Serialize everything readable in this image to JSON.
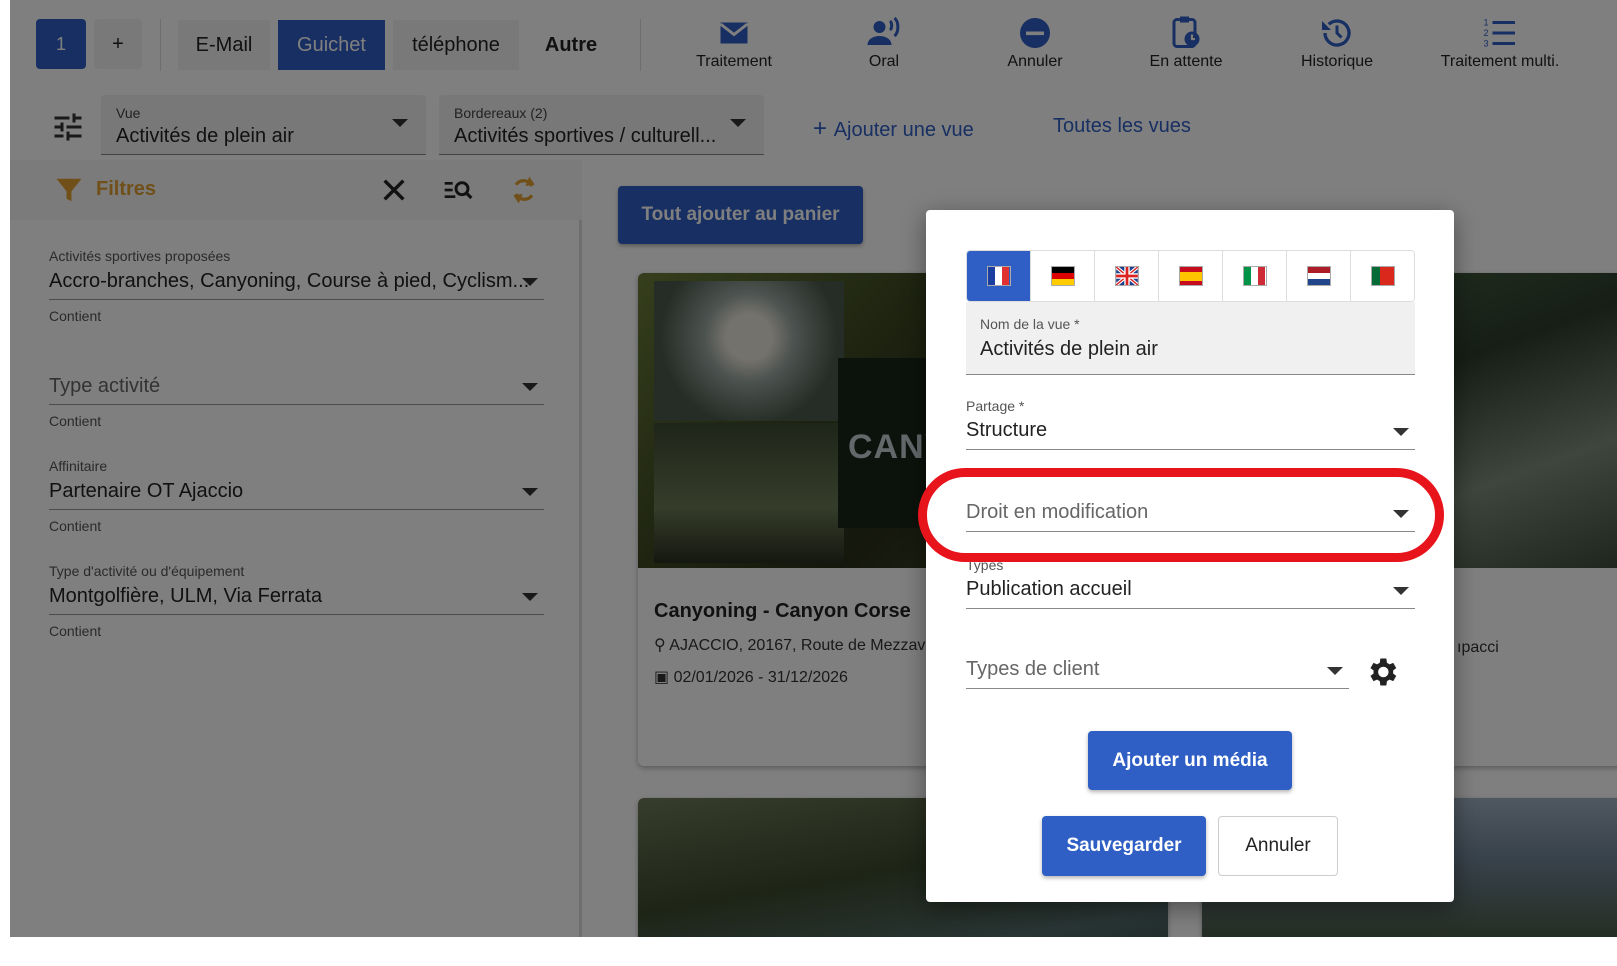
{
  "topbar": {
    "counter": "1",
    "add": "+",
    "channels": {
      "email": "E-Mail",
      "guichet": "Guichet",
      "telephone": "téléphone",
      "autre": "Autre"
    },
    "tools": {
      "traitement": "Traitement",
      "oral": "Oral",
      "annuler": "Annuler",
      "en_attente": "En attente",
      "historique": "Historique",
      "traitement_multi": "Traitement multi."
    }
  },
  "viewbar": {
    "vue_label": "Vue",
    "vue_value": "Activités de plein air",
    "bordereaux_label": "Bordereaux (2)",
    "bordereaux_value": "Activités sportives / culturell...",
    "add_view": "Ajouter une vue",
    "all_views": "Toutes les vues"
  },
  "filters": {
    "title": "Filtres",
    "fields": [
      {
        "label": "Activités sportives proposées",
        "value": "Accro-branches, Canyoning, Course à pied, Cyclism...",
        "hint": "Contient"
      },
      {
        "label": "",
        "placeholder": "Type activité",
        "hint": "Contient"
      },
      {
        "label": "Affinitaire",
        "value": "Partenaire OT Ajaccio",
        "hint": "Contient"
      },
      {
        "label": "Type d'activité ou d'équipement",
        "value": "Montgolfière, ULM, Via Ferrata",
        "hint": "Contient"
      }
    ]
  },
  "main": {
    "cart_button": "Tout ajouter au panier",
    "card1": {
      "logo_text": "CANYO CORS",
      "title": "Canyoning - Canyon Corse",
      "address": "AJACCIO, 20167, Route de Mezzav",
      "dates": "02/01/2026 - 31/12/2026"
    },
    "card2": {
      "partial_text": "ıpacci"
    }
  },
  "modal": {
    "languages": [
      "fr",
      "de",
      "en",
      "es",
      "it",
      "nl",
      "pt"
    ],
    "name_label": "Nom de la vue *",
    "name_value": "Activités de plein air",
    "partage_label": "Partage *",
    "partage_value": "Structure",
    "droit_placeholder": "Droit en modification",
    "types_label": "Types",
    "types_value": "Publication accueil",
    "client_placeholder": "Types de client",
    "media_button": "Ajouter un média",
    "save_button": "Sauvegarder",
    "cancel_button": "Annuler"
  },
  "colors": {
    "primary": "#2f5fc4",
    "filter_accent": "#e0a030",
    "highlight": "#e8141c",
    "overlay": "rgba(0,0,0,0.5)"
  }
}
